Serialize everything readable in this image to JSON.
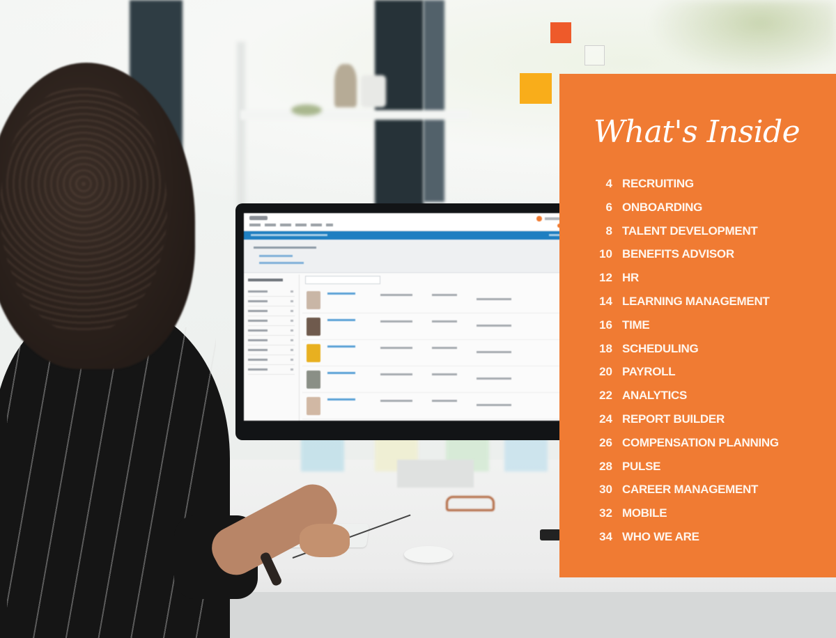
{
  "panel": {
    "heading": "What's Inside",
    "background_color": "#f07b33",
    "text_color": "#ffffff"
  },
  "decorative_squares": [
    {
      "name": "red-square",
      "color": "#ee5a2a"
    },
    {
      "name": "outline-square",
      "color": "#cfcfcf"
    },
    {
      "name": "yellow-square",
      "color": "#f9ad1a"
    }
  ],
  "toc": [
    {
      "page": "4",
      "title": "RECRUITING"
    },
    {
      "page": "6",
      "title": "ONBOARDING"
    },
    {
      "page": "8",
      "title": "TALENT DEVELOPMENT"
    },
    {
      "page": "10",
      "title": "BENEFITS ADVISOR"
    },
    {
      "page": "12",
      "title": "HR"
    },
    {
      "page": "14",
      "title": "LEARNING MANAGEMENT"
    },
    {
      "page": "16",
      "title": "TIME"
    },
    {
      "page": "18",
      "title": "SCHEDULING"
    },
    {
      "page": "20",
      "title": "PAYROLL"
    },
    {
      "page": "22",
      "title": "ANALYTICS"
    },
    {
      "page": "24",
      "title": "REPORT BUILDER"
    },
    {
      "page": "26",
      "title": "COMPENSATION PLANNING"
    },
    {
      "page": "28",
      "title": "PULSE"
    },
    {
      "page": "30",
      "title": "CAREER MANAGEMENT"
    },
    {
      "page": "32",
      "title": "MOBILE"
    },
    {
      "page": "34",
      "title": "WHO WE ARE"
    }
  ],
  "photo": {
    "description": "Woman with curly hair seated at a white desk using a desktop monitor showing an HR people directory",
    "screen_accent_color": "#1f7fc1",
    "screen_highlight_color": "#f07a2f"
  }
}
